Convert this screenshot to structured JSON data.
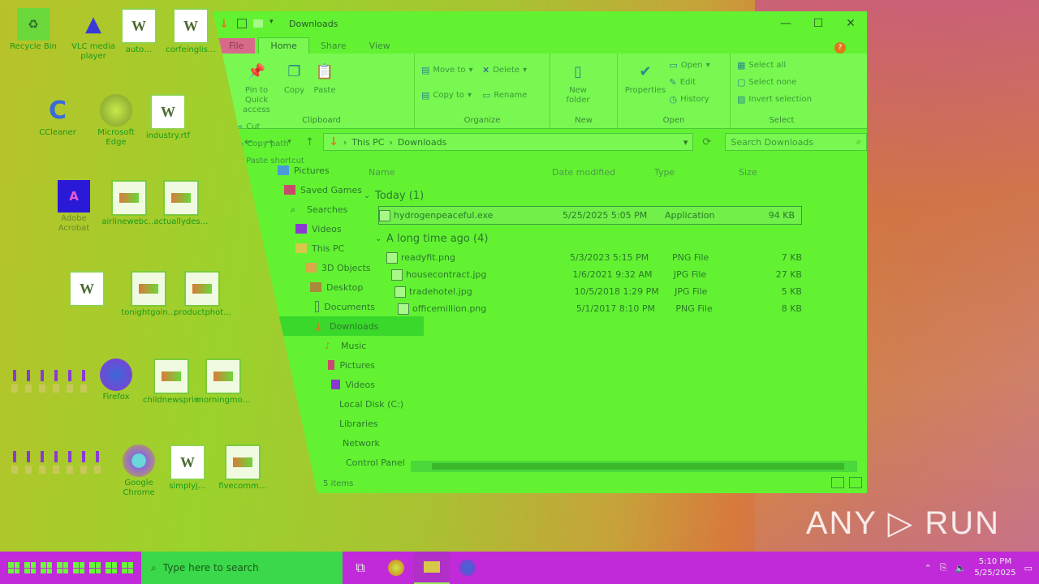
{
  "desktop": {
    "icons": [
      {
        "label": "Recycle Bin",
        "glyph": "recycle-bin",
        "kind": "bin"
      },
      {
        "label": "VLC media player",
        "glyph": "vlc-cone",
        "kind": "vlc"
      },
      {
        "label": "auto…",
        "glyph": "W",
        "kind": "doc"
      },
      {
        "label": "corfeinglis…",
        "glyph": "W",
        "kind": "doc"
      },
      {
        "label": "CCleaner",
        "glyph": "C",
        "kind": "cc"
      },
      {
        "label": "Microsoft Edge",
        "glyph": "edge",
        "kind": "edge"
      },
      {
        "label": "industry.rtf",
        "glyph": "W",
        "kind": "doc"
      },
      {
        "label": "Adobe Acrobat",
        "glyph": "A",
        "kind": "pdf"
      },
      {
        "label": "airlinewebc…",
        "glyph": "png",
        "kind": "png"
      },
      {
        "label": "actuallydes…",
        "glyph": "png",
        "kind": "png"
      },
      {
        "label": "",
        "glyph": "W",
        "kind": "doc"
      },
      {
        "label": "tonightgoin…",
        "glyph": "png",
        "kind": "png"
      },
      {
        "label": "productphot…",
        "glyph": "png",
        "kind": "png"
      },
      {
        "label": "Firefox",
        "glyph": "firefox",
        "kind": "firefox"
      },
      {
        "label": "childnewsprin…",
        "glyph": "png",
        "kind": "png"
      },
      {
        "label": "morningmo…",
        "glyph": "png",
        "kind": "png"
      },
      {
        "label": "Google Chrome",
        "glyph": "chrome",
        "kind": "chrome"
      },
      {
        "label": "simplyj…",
        "glyph": "W",
        "kind": "doc"
      },
      {
        "label": "fivecomm…",
        "glyph": "png",
        "kind": "png"
      }
    ]
  },
  "window": {
    "title": "Downloads",
    "tabs": [
      "File",
      "Home",
      "Share",
      "View"
    ],
    "active_tab": "Home",
    "ribbon": {
      "clipboard": {
        "label": "Clipboard",
        "pin": "Pin to Quick access",
        "copy": "Copy",
        "paste": "Paste",
        "cut": "Cut",
        "copy_path": "Copy path",
        "paste_shortcut": "Paste shortcut"
      },
      "organize": {
        "label": "Organize",
        "move_to": "Move to",
        "copy_to": "Copy to",
        "delete": "Delete",
        "rename": "Rename"
      },
      "new": {
        "label": "New",
        "new_folder": "New folder"
      },
      "open": {
        "label": "Open",
        "properties": "Properties",
        "open": "Open",
        "edit": "Edit",
        "history": "History"
      },
      "select": {
        "label": "Select",
        "select_all": "Select all",
        "select_none": "Select none",
        "invert": "Invert selection"
      }
    },
    "address": {
      "root": "This PC",
      "folder": "Downloads",
      "search_placeholder": "Search Downloads"
    },
    "nav": [
      "Pictures",
      "Saved Games",
      "Searches",
      "Videos",
      "This PC",
      "3D Objects",
      "Desktop",
      "Documents",
      "Downloads",
      "Music",
      "Pictures",
      "Videos",
      "Local Disk (C:)",
      "Libraries",
      "Network",
      "Control Panel"
    ],
    "nav_selected": 8,
    "columns": {
      "name": "Name",
      "date": "Date modified",
      "type": "Type",
      "size": "Size"
    },
    "groups": [
      {
        "title": "Today (1)",
        "files": [
          {
            "name": "hydrogenpeaceful.exe",
            "date": "5/25/2025 5:05 PM",
            "type": "Application",
            "size": "94 KB"
          }
        ]
      },
      {
        "title": "A long time ago (4)",
        "files": [
          {
            "name": "readyfit.png",
            "date": "5/3/2023 5:15 PM",
            "type": "PNG File",
            "size": "7 KB"
          },
          {
            "name": "housecontract.jpg",
            "date": "1/6/2021 9:32 AM",
            "type": "JPG File",
            "size": "27 KB"
          },
          {
            "name": "tradehotel.jpg",
            "date": "10/5/2018 1:29 PM",
            "type": "JPG File",
            "size": "5 KB"
          },
          {
            "name": "officemillion.png",
            "date": "5/1/2017 8:10 PM",
            "type": "PNG File",
            "size": "8 KB"
          }
        ]
      }
    ],
    "status": "5 items"
  },
  "taskbar": {
    "search_placeholder": "Type here to search",
    "time": "5:10 PM",
    "date": "5/25/2025"
  },
  "watermark": "ANY ▷ RUN"
}
